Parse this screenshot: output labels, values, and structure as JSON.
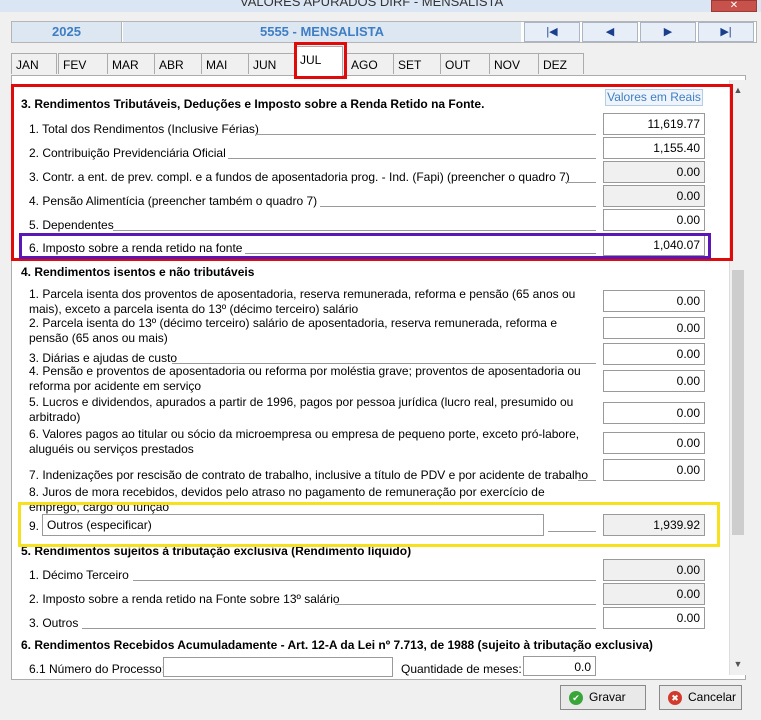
{
  "window": {
    "title": "VALORES APURADOS DIRF - MENSALISTA",
    "close_label": "✕"
  },
  "header": {
    "year": "2025",
    "period": "5555 - MENSALISTA",
    "nav": [
      "|◀",
      "◀",
      "▶",
      "▶|"
    ]
  },
  "tabs": [
    "JAN",
    "FEV",
    "MAR",
    "ABR",
    "MAI",
    "JUN",
    "JUL",
    "AGO",
    "SET",
    "OUT",
    "NOV",
    "DEZ"
  ],
  "active_tab": "JUL",
  "values_header": "Valores em Reais",
  "section3": {
    "title": "3. Rendimentos Tributáveis, Deduções e Imposto sobre a Renda Retido na Fonte.",
    "items": [
      {
        "label": "1. Total dos Rendimentos (Inclusive Férias)",
        "value": "11,619.77"
      },
      {
        "label": "2. Contribuição Previdenciária Oficial",
        "value": "1,155.40"
      },
      {
        "label": "3. Contr. a ent. de prev. compl. e a fundos de aposentadoria prog. - Ind. (Fapi) (preencher o quadro 7)",
        "value": "0.00"
      },
      {
        "label": "4. Pensão Alimentícia  (preencher também o quadro 7)",
        "value": "0.00"
      },
      {
        "label": "5. Dependentes",
        "value": "0.00"
      },
      {
        "label": "6. Imposto sobre a renda retido na fonte",
        "value": "1,040.07"
      }
    ]
  },
  "section4": {
    "title": "4. Rendimentos isentos e não tributáveis",
    "items": [
      {
        "label": "1. Parcela isenta dos proventos de aposentadoria, reserva remunerada, reforma e pensão (65 anos ou mais), exceto a parcela isenta do 13º (décimo terceiro) salário",
        "value": "0.00"
      },
      {
        "label": "2. Parcela isenta do 13º (décimo terceiro) salário de aposentadoria, reserva remunerada, reforma e pensão (65 anos ou mais)",
        "value": "0.00"
      },
      {
        "label": "3. Diárias e ajudas de custo",
        "value": "0.00"
      },
      {
        "label": "4. Pensão e proventos de aposentadoria ou reforma por moléstia grave; proventos de aposentadoria ou reforma por acidente em serviço",
        "value": "0.00"
      },
      {
        "label": "5. Lucros e dividendos, apurados a partir de 1996, pagos por pessoa jurídica (lucro real, presumido ou arbitrado)",
        "value": "0.00"
      },
      {
        "label": "6. Valores pagos ao titular ou sócio da microempresa ou empresa de pequeno porte, exceto pró-labore, aluguéis ou serviços prestados",
        "value": "0.00"
      },
      {
        "label": "7. Indenizações por rescisão de contrato de trabalho, inclusive a título de PDV e por acidente de trabalho",
        "value": "0.00"
      },
      {
        "label": "8. Juros de mora recebidos, devidos pelo atraso no pagamento de remuneração por exercício de emprego, cargo ou função",
        "value": ""
      }
    ],
    "other_number": "9.",
    "other_text": "Outros (especificar)",
    "other_value": "1,939.92"
  },
  "section5": {
    "title": "5. Rendimentos sujeitos à tributação exclusiva (Rendimento líquido)",
    "items": [
      {
        "label": "1. Décimo Terceiro",
        "value": "0.00"
      },
      {
        "label": "2. Imposto sobre a renda retido na Fonte sobre 13º salário",
        "value": "0.00"
      },
      {
        "label": "3. Outros",
        "value": "0.00"
      }
    ]
  },
  "section6": {
    "title": "6. Rendimentos Recebidos Acumuladamente - Art. 12-A da Lei nº 7.713, de 1988 (sujeito à tributação exclusiva)",
    "process_label": "6.1 Número do Processo:",
    "process_value": "",
    "months_label": "Quantidade de meses:",
    "months_value": "0.0"
  },
  "buttons": {
    "save": "Gravar",
    "cancel": "Cancelar"
  },
  "colors": {
    "highlight_red": "#e10a0a",
    "highlight_purple": "#5b16b6",
    "highlight_yellow": "#f7e11e",
    "accent_blue": "#3f7ec4"
  }
}
